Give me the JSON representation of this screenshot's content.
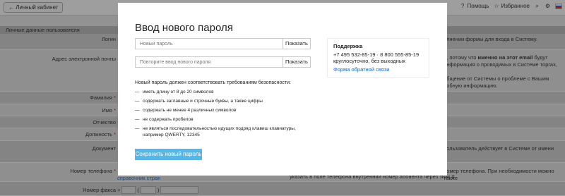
{
  "topbar": {
    "back_label": "← Личный кабинет",
    "help_label": "Помощь",
    "favorites_label": "Избранное",
    "icons": {
      "help": "help-icon",
      "favorites": "star-icon",
      "search": "search-icon",
      "settings": "settings-icon",
      "language": "flag-ru-icon"
    }
  },
  "form": {
    "section_title": "Личные данные пользователя",
    "fields": {
      "login": "Логин",
      "email": "Адрес электронной почты",
      "lastname": "Фамилия",
      "firstname": "Имя",
      "patronymic": "Отчество",
      "position": "Должность",
      "document": "Документ",
      "phone": "Номер телефона",
      "fax": "Номер факса"
    },
    "required_mark": "*",
    "right_texts": {
      "login": "олнении формы для входа в Систему.",
      "email_1": "е, потому что ",
      "email_bold": "именно на этот email",
      "email_2": " будут",
      "email_3": "информация о проводимых в Системе торгах,",
      "email_4": "общение от Системы о проблеме с Вашим",
      "email_5": "робную информацию.",
      "document_1": "пользователь действует в Системе от имени",
      "phone": "номер телефона. При необходимости можно также"
    },
    "phone_note": "указать в поле телефона внутренний номер абонента через знак #.",
    "countries_link": "справочник стран",
    "fax_plus": "+",
    "fax_paren_open": "(",
    "fax_paren_close": ")"
  },
  "modal": {
    "title": "Ввод нового пароля",
    "new_password_placeholder": "Новый пароль",
    "repeat_password_placeholder": "Повторите ввод нового пароля",
    "show_label": "Показать",
    "requirements_title": "Новый пароль должен соответствовать требованиям безопасности:",
    "requirements": [
      "иметь длину от 8 до 20 символов",
      "содержать заглавные и строчные буквы, а также цифры",
      "содержать не менее 4 различных символов",
      "не содержать пробелов",
      "не являться последовательностью идущих подряд клавиш клавиатуры, например QWERTY, 12345"
    ],
    "dash": "—",
    "save_label": "Сохранить новый пароль",
    "support": {
      "title": "Поддержка",
      "phones": "+7 495 532-85-19 · 8 800 555-85-19",
      "hours": "круглосуточно, без выходных",
      "feedback_link": "Форма обратной связи"
    }
  },
  "colors": {
    "accent_button": "#56b7e7",
    "link": "#1565c0",
    "required": "#cc0000"
  }
}
